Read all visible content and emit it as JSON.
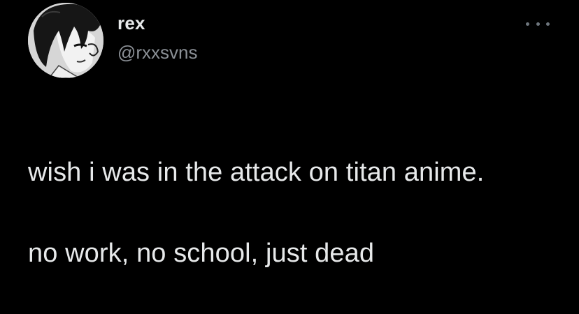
{
  "tweet": {
    "author": {
      "display_name": "rex",
      "handle": "@rxxsvns",
      "avatar_icon": "anime-character-avatar"
    },
    "more_icon": "more-horizontal-icon",
    "text_lines": [
      "wish i was in the attack on titan anime.",
      "no work, no school, just dead"
    ]
  },
  "colors": {
    "background": "#000000",
    "primary_text": "#e7e9ea",
    "secondary_text": "#8b9096",
    "icon": "#6e767d"
  }
}
